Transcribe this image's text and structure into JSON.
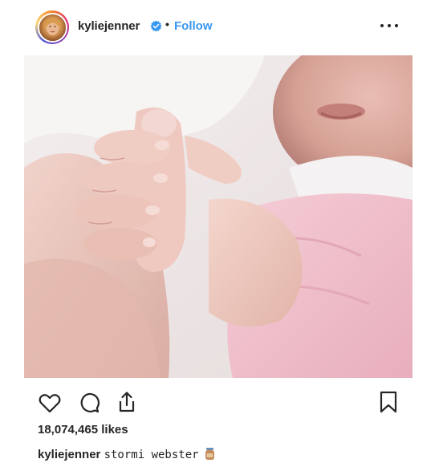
{
  "post": {
    "username": "kyliejenner",
    "verified": true,
    "separator": "•",
    "follow_label": "Follow",
    "more_icon": "more-horizontal-icon",
    "image_description_icon": "photo",
    "likes_text": "18,074,465 likes",
    "caption": {
      "username": "kyliejenner",
      "text": "stormi webster"
    },
    "actions": {
      "like_icon": "heart-icon",
      "comment_icon": "comment-icon",
      "share_icon": "share-icon",
      "save_icon": "bookmark-icon"
    }
  },
  "colors": {
    "text": "#262626",
    "link": "#3897f0",
    "verified_badge": "#3897f0",
    "background": "#ffffff"
  }
}
